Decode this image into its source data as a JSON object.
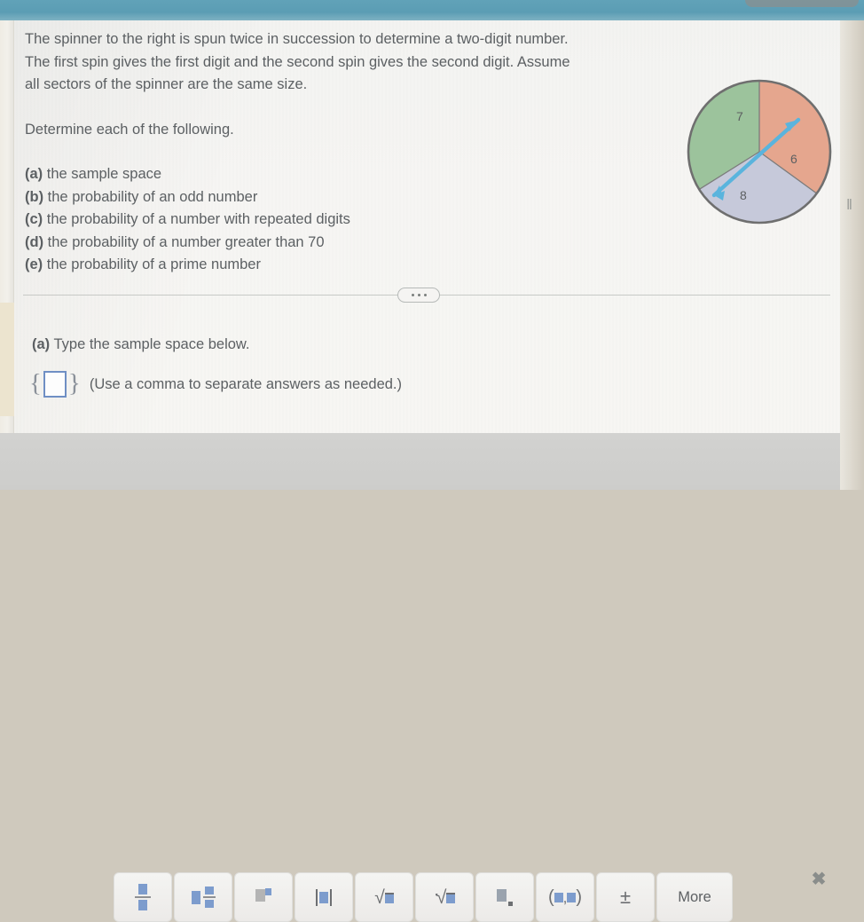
{
  "window": {
    "top_band_color": "#5b9db4",
    "page_background": "#f6f5f3"
  },
  "problem": {
    "line1": "The spinner to the right is spun twice in succession to determine a two-digit number.",
    "line2": "The first spin gives the first digit and the second spin gives the second digit. Assume",
    "line3": "all sectors of the spinner are the same size.",
    "instruction": "Determine each of the following.",
    "parts": [
      {
        "label": "(a)",
        "text": "the sample space"
      },
      {
        "label": "(b)",
        "text": "the probability of an odd number"
      },
      {
        "label": "(c)",
        "text": "the probability of a number with repeated digits"
      },
      {
        "label": "(d)",
        "text": "the probability of a number greater than 70"
      },
      {
        "label": "(e)",
        "text": "the probability of a prime number"
      }
    ]
  },
  "spinner": {
    "sectors": [
      {
        "label": "7",
        "color": "#9cc39c",
        "start_deg": -90,
        "end_deg": -212
      },
      {
        "label": "6",
        "color": "#e5a68e",
        "start_deg": -90,
        "end_deg": 36
      },
      {
        "label": "8",
        "color": "#c6c9da",
        "start_deg": 36,
        "end_deg": 148
      }
    ],
    "arrow_color": "#5ab4dd",
    "outline_color": "#6f6f6f"
  },
  "divider": {
    "expand_button_label": "..."
  },
  "answer_section": {
    "prompt_label": "(a)",
    "prompt_text": "Type the sample space below.",
    "open_brace": "{",
    "close_brace": "}",
    "input_value": "",
    "input_placeholder": "",
    "hint": "(Use a comma to separate answers as needed.)"
  },
  "palette": {
    "buttons": [
      {
        "name": "fraction",
        "glyph": "fraction"
      },
      {
        "name": "mixed-number",
        "glyph": "mixed"
      },
      {
        "name": "exponent",
        "glyph": "exponent"
      },
      {
        "name": "absolute-value",
        "glyph": "absolute"
      },
      {
        "name": "square-root",
        "glyph": "sqrt"
      },
      {
        "name": "nth-root",
        "glyph": "nthroot"
      },
      {
        "name": "subscript",
        "glyph": "subscript"
      },
      {
        "name": "ordered-pair",
        "glyph": "ordered-pair"
      },
      {
        "name": "plus-minus",
        "glyph": "plusminus",
        "text": "±"
      },
      {
        "name": "more",
        "glyph": "text",
        "text": "More"
      }
    ],
    "close_label": "✖"
  },
  "scrollbar": {
    "ticks": "‖"
  }
}
